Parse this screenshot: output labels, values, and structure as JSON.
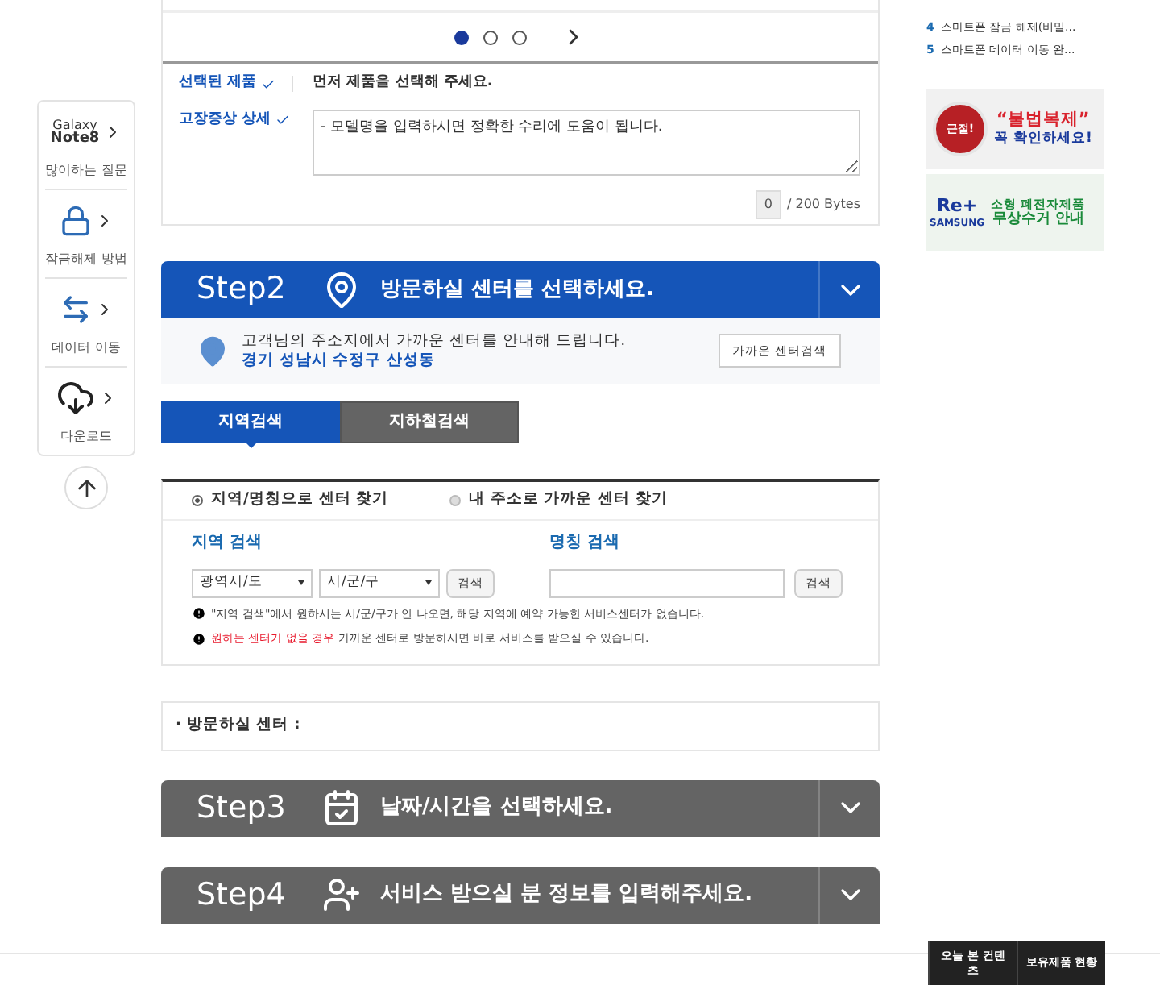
{
  "quick_menu": [
    {
      "title": "Galaxy",
      "subtitle": "Note8",
      "label": "많이하는 질문",
      "kind": "text"
    },
    {
      "label": "잠금해제 방법",
      "kind": "lock"
    },
    {
      "label": "데이터 이동",
      "kind": "transfer"
    },
    {
      "label": "다운로드",
      "kind": "download"
    }
  ],
  "carousel_dots": [
    {
      "selected": true
    },
    {
      "selected": false
    },
    {
      "selected": false
    }
  ],
  "product": {
    "label": "선택된 제품",
    "value": "먼저 제품을 선택해 주세요."
  },
  "symptom": {
    "label": "고장증상 상세",
    "placeholder": "- 모델명을 입력하시면 정확한 수리에 도움이 됩니다.",
    "count": "0",
    "limit": "/ 200 Bytes"
  },
  "steps": [
    {
      "step": "Step2",
      "title": "방문하실 센터를 선택하세요.",
      "kind": "map",
      "active": true
    },
    {
      "step": "Step3",
      "title": "날짜/시간을 선택하세요.",
      "kind": "calendar",
      "active": false
    },
    {
      "step": "Step4",
      "title": "서비스 받으실 분 정보를 입력해주세요.",
      "kind": "person",
      "active": false
    }
  ],
  "location": {
    "message": "고객님의 주소지에서 가까운 센터를 안내해 드립니다.",
    "address": "경기 성남시 수정구 산성동",
    "button": "가까운 센터검색"
  },
  "search_tabs": [
    {
      "label": "지역검색",
      "selected": true
    },
    {
      "label": "지하철검색",
      "selected": false
    }
  ],
  "modes": [
    {
      "label": "지역/명칭으로 센터 찾기",
      "selected": true
    },
    {
      "label": "내 주소로 가까운 센터 찾기",
      "selected": false
    }
  ],
  "region_search": {
    "title": "지역 검색",
    "selects": [
      "광역시/도",
      "시/군/구"
    ],
    "button": "검색"
  },
  "name_search": {
    "title": "명칭 검색",
    "button": "검색"
  },
  "notices": [
    "\"지역 검색\"에서 원하시는 시/군/구가 안 나오면, 해당 지역에 예약 가능한 서비스센터가 없습니다.",
    "**원하는 센터가 없을 경우** 가까운 센터로 방문하시면 바로 서비스를 받으실 수 있습니다."
  ],
  "visit_center": "· 방문하실 센터 :",
  "popular": [
    {
      "rank": "4",
      "text": "스마트폰 잠금 해제(비밀..."
    },
    {
      "rank": "5",
      "text": "스마트폰 데이터 이동 완..."
    }
  ],
  "banners": [
    {
      "kind": "copyright",
      "badge": "근절!",
      "title": "“불법복제”",
      "subtitle": "꼭 확인하세요!"
    },
    {
      "kind": "recycle",
      "brand": "Re+",
      "company": "SAMSUNG",
      "title": "소형 폐전자제품",
      "subtitle": "무상수거 안내"
    }
  ],
  "bottom_tabs": [
    "오늘 본 컨텐츠",
    "보유제품 현황"
  ]
}
